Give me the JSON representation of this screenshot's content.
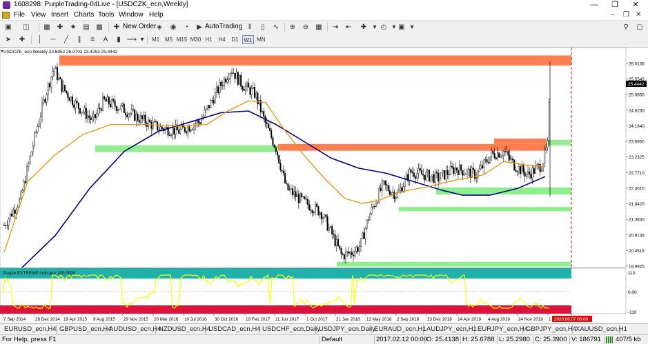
{
  "window": {
    "title": "1608298: PurpleTrading-04Live - [USDCZK_ecn,Weekly]",
    "minimize": "—",
    "maximize": "❐",
    "close": "✕"
  },
  "menu": {
    "items": [
      "File",
      "View",
      "Insert",
      "Charts",
      "Tools",
      "Window",
      "Help"
    ],
    "mdi_minimize": "–",
    "mdi_restore": "❐",
    "mdi_close": "✕"
  },
  "toolbar": {
    "new_order": "New Order",
    "autotrading": "AutoTrading",
    "timeframes": [
      "M1",
      "M5",
      "M15",
      "M30",
      "H1",
      "H4",
      "D1",
      "W1",
      "MN"
    ],
    "active_timeframe": "W1"
  },
  "chart": {
    "header": "USDCZK_ecn,Weekly  23.6952 26.0703 23.4253 25.4442",
    "current_price": "25.4442",
    "price_labels": [
      "26.0135",
      "25.5545",
      "25.0850",
      "24.6230",
      "24.1640",
      "23.6950",
      "23.2325",
      "22.7710",
      "22.3010",
      "21.8420",
      "21.3830",
      "20.9135",
      "20.4515",
      "19.9925"
    ],
    "date_labels": [
      "7 Sep 2014",
      "28 Dec 2014",
      "19 Apr 2015",
      "9 Aug 2015",
      "29 Nov 2015",
      "20 Mar 2016",
      "10 Jul 2016",
      "30 Oct 2016",
      "19 Feb 2017",
      "11 Jun 2017",
      "1 Oct 2017",
      "21 Jan 2018",
      "13 May 2018",
      "2 Sep 2018",
      "23 Dec 2018",
      "14 Apr 2019",
      "4 Aug 2019",
      "24 Nov 2019",
      "1"
    ],
    "cursor_date": "2020.06.07 00:00",
    "indicator": {
      "label": "Purple EXTREME Indicator 100.0000",
      "levels": [
        "110",
        "0.00",
        "-110"
      ]
    },
    "colors": {
      "resistance": "#ff7f50",
      "support": "#90ee90",
      "ma_fast": "#f0900a",
      "ma_slow": "#000080",
      "indicator_line": "#ffff00",
      "indicator_top": "#20b2aa",
      "indicator_bottom": "#dc143c",
      "cursor_line": "#e01010"
    }
  },
  "tabs": [
    "EURUSD_ecn,H4",
    "GBPUSD_ecn,H4",
    "AUDUSD_ecn,H4",
    "NZDUSD_ecn,H4",
    "USDCAD_ecn,H4",
    "USDCHF_ecn,Daily",
    "USDJPY_ecn,Daily",
    "EURAUD_ecn,H1",
    "AUDJPY_ecn,H1",
    "EURJPY_ecn,H4",
    "GBPJPY_ecn,H4",
    "XAUUSD_ecn,H1"
  ],
  "status": {
    "help": "For Help, press F1",
    "profile": "Default",
    "datetime": "2017.02.12 00:00",
    "open": "O: 25.4138",
    "high": "H: 25.6788",
    "low": "L: 25.2980",
    "close": "C: 25.3900",
    "volume": "V: 186791",
    "traffic": "407/5 kb"
  }
}
